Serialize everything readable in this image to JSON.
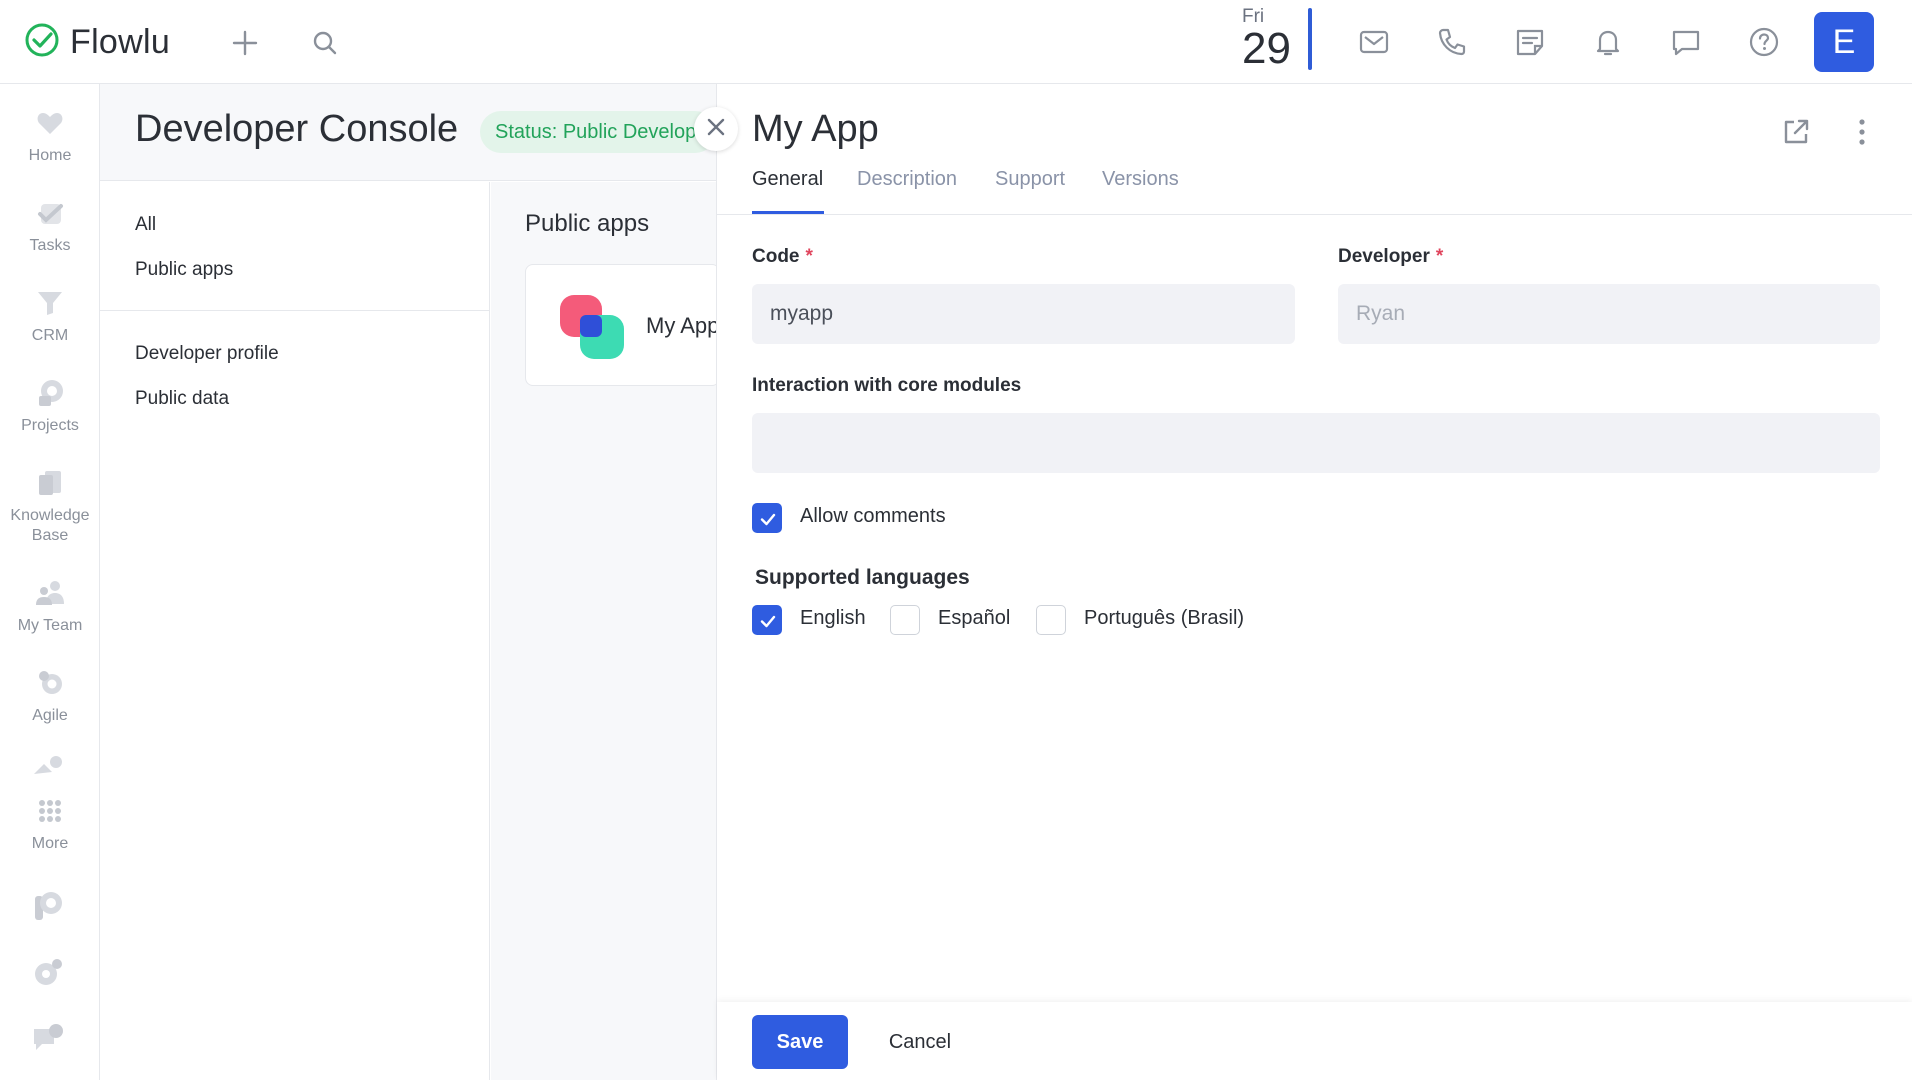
{
  "app": {
    "name": "Flowlu"
  },
  "topbar": {
    "date_day": "Fri",
    "date_num": "29",
    "avatar_letter": "E",
    "icons": [
      "plus-icon",
      "search-icon",
      "mail-icon",
      "phone-icon",
      "notes-icon",
      "bell-icon",
      "chat-icon",
      "help-icon"
    ]
  },
  "sidebar": {
    "items": [
      {
        "label": "Home",
        "icon": "heart-icon"
      },
      {
        "label": "Tasks",
        "icon": "check-icon"
      },
      {
        "label": "CRM",
        "icon": "funnel-icon"
      },
      {
        "label": "Projects",
        "icon": "projects-icon"
      },
      {
        "label": "Knowledge Base",
        "icon": "book-icon"
      },
      {
        "label": "My Team",
        "icon": "team-icon"
      },
      {
        "label": "Agile",
        "icon": "agile-icon"
      },
      {
        "label": "More",
        "icon": "grid-dots-icon"
      }
    ]
  },
  "console": {
    "title": "Developer Console",
    "status": "Status: Public Developer",
    "menu": [
      "All",
      "Public apps",
      "Developer profile",
      "Public data"
    ],
    "section_title": "Public apps",
    "app_card_name": "My App"
  },
  "panel": {
    "title": "My App",
    "tabs": [
      "General",
      "Description",
      "Support",
      "Versions"
    ],
    "active_tab": "General",
    "fields": {
      "code_label": "Code",
      "code_value": "myapp",
      "developer_label": "Developer",
      "developer_value": "Ryan",
      "required_mark": "*",
      "interaction_label": "Interaction with core modules",
      "interaction_value": ""
    },
    "allow_comments": {
      "label": "Allow comments",
      "checked": true
    },
    "languages": {
      "label": "Supported languages",
      "options": [
        {
          "label": "English",
          "checked": true
        },
        {
          "label": "Español",
          "checked": false
        },
        {
          "label": "Português (Brasil)",
          "checked": false
        }
      ]
    },
    "buttons": {
      "save": "Save",
      "cancel": "Cancel"
    }
  },
  "colors": {
    "accent": "#2f5ce0",
    "status_green": "#22a35a",
    "required": "#e0455d"
  }
}
